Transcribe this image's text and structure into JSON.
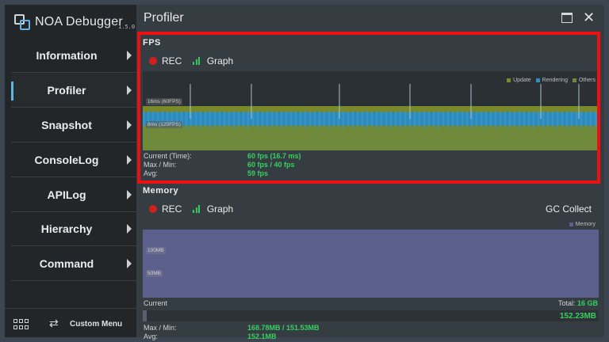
{
  "brand": {
    "name": "NOA Debugger",
    "version": "1.5.0"
  },
  "sidebar": {
    "items": [
      {
        "label": "Information",
        "active": false
      },
      {
        "label": "Profiler",
        "active": true
      },
      {
        "label": "Snapshot",
        "active": false
      },
      {
        "label": "ConsoleLog",
        "active": false
      },
      {
        "label": "APILog",
        "active": false
      },
      {
        "label": "Hierarchy",
        "active": false
      },
      {
        "label": "Command",
        "active": false
      }
    ],
    "footer": {
      "custom_menu": "Custom Menu",
      "grid_icon": "grid-icon",
      "swap_icon": "swap-arrows-icon"
    }
  },
  "header": {
    "title": "Profiler",
    "window_icon": "window-icon",
    "close_icon": "close-icon"
  },
  "fps": {
    "title": "FPS",
    "rec_label": "REC",
    "graph_label": "Graph",
    "legend": [
      {
        "name": "Update",
        "color": "#7a8a2a"
      },
      {
        "name": "Rendering",
        "color": "#2f8fc0"
      },
      {
        "name": "Others",
        "color": "#6e8a3a"
      }
    ],
    "guide_16ms": "16ms (60FPS)",
    "guide_8ms": "8ms (120FPS)",
    "stats": {
      "current_label": "Current (Time):",
      "current_value": "60 fps (16.7 ms)",
      "maxmin_label": "Max / Min:",
      "maxmin_value": "60 fps / 40 fps",
      "avg_label": "Avg:",
      "avg_value": "59 fps"
    }
  },
  "memory": {
    "title": "Memory",
    "rec_label": "REC",
    "graph_label": "Graph",
    "gc_label": "GC Collect",
    "legend": "Memory",
    "legend_color": "#5a5f8c",
    "guide_100": "100MB",
    "guide_50": "50MB",
    "current_label": "Current",
    "total_label": "Total:",
    "total_value": "16 GB",
    "current_value": "152.23MB",
    "usage_fraction": 0.0095,
    "maxmin_label": "Max / Min:",
    "maxmin_value": "168.78MB / 151.53MB",
    "avg_label": "Avg:",
    "avg_value": "152.1MB"
  }
}
